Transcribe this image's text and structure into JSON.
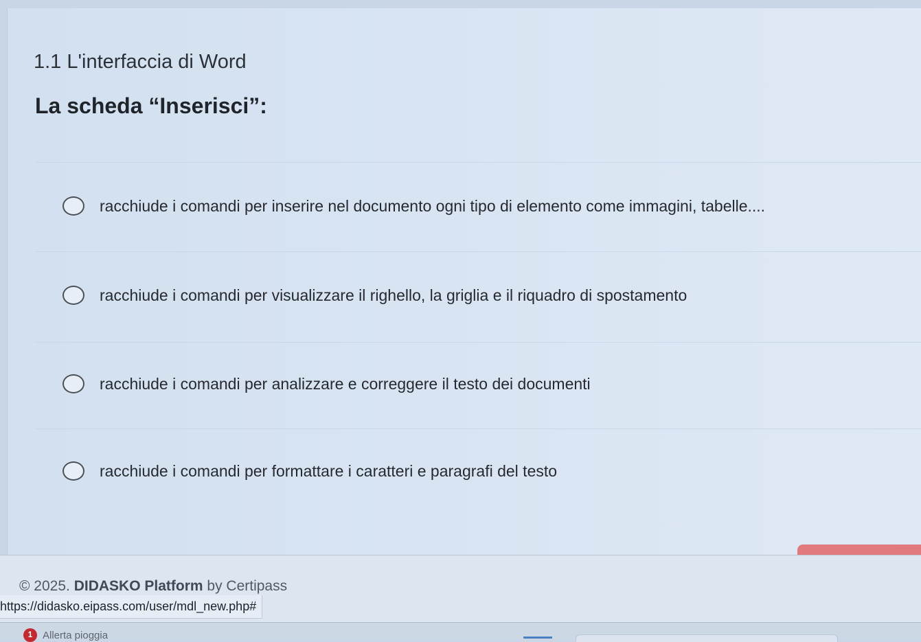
{
  "section": {
    "title": "1.1 L'interfaccia di Word"
  },
  "question": {
    "text": "La scheda “Inserisci”:",
    "options": [
      "racchiude i comandi per inserire nel documento ogni tipo di elemento come immagini, tabelle....",
      "racchiude i comandi per visualizzare il righello, la griglia e il riquadro di spostamento",
      "racchiude i comandi per analizzare e correggere il testo dei documenti",
      "racchiude i comandi per formattare i caratteri e paragrafi del testo"
    ]
  },
  "footer": {
    "copyright_prefix": "© 2025.",
    "brand": "DIDASKO Platform",
    "suffix": "by Certipass",
    "status_url": "https://didasko.eipass.com/user/mdl_new.php#"
  },
  "taskbar": {
    "weather_badge": "1",
    "weather_text": "Allerta pioggia"
  },
  "colors": {
    "action_button": "#e07a7e",
    "weather_badge": "#c4272d"
  }
}
